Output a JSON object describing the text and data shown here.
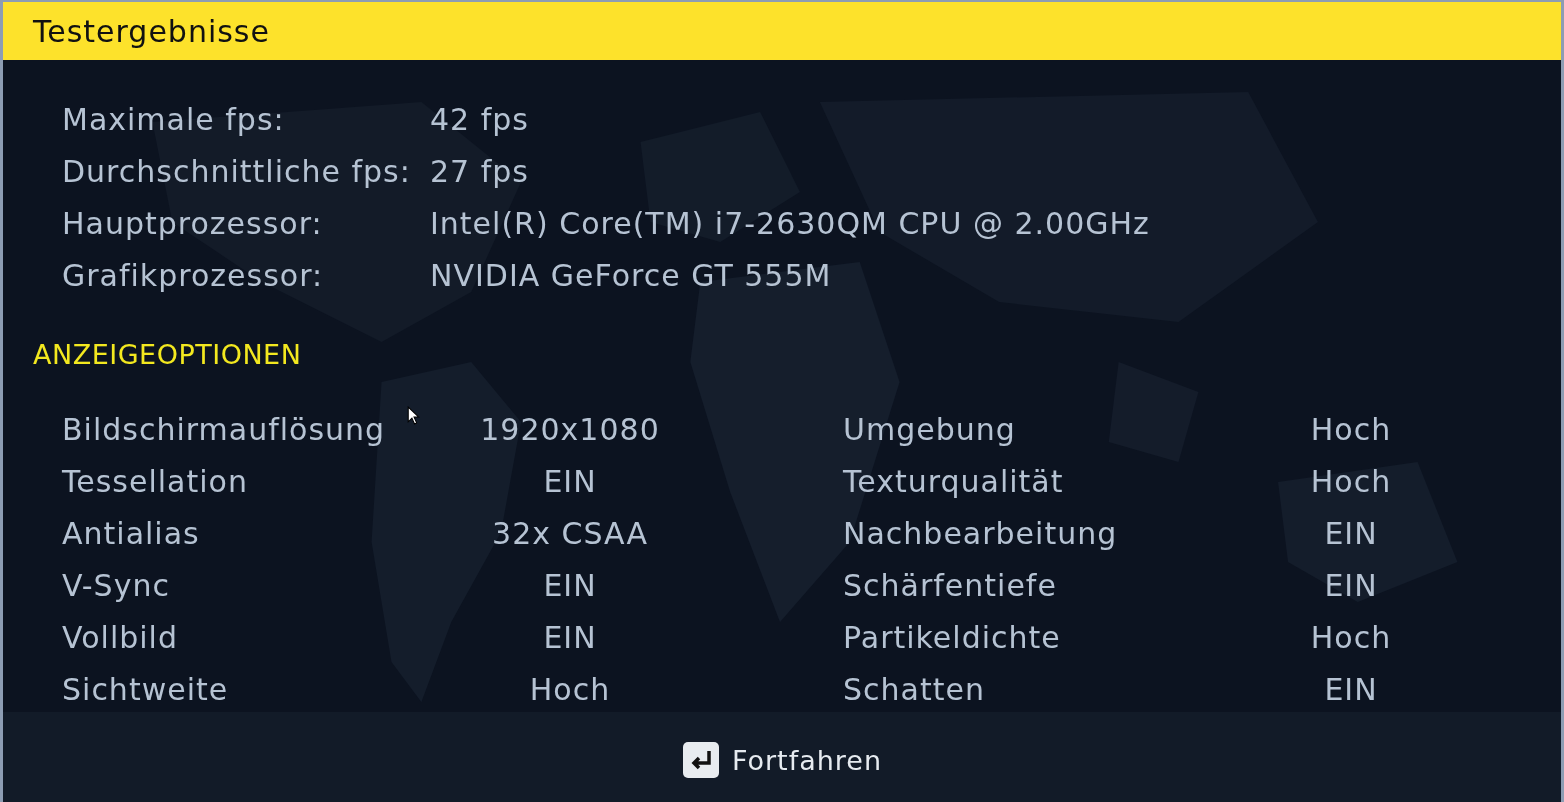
{
  "title": "Testergebnisse",
  "results": [
    {
      "label": "Maximale fps:",
      "value": "42 fps"
    },
    {
      "label": "Durchschnittliche fps:",
      "value": "27 fps"
    },
    {
      "label": "Hauptprozessor:",
      "value": "Intel(R) Core(TM) i7-2630QM CPU @ 2.00GHz"
    },
    {
      "label": "Grafikprozessor:",
      "value": "NVIDIA GeForce GT 555M"
    }
  ],
  "section_heading": "ANZEIGEOPTIONEN",
  "options": [
    {
      "left": {
        "label": "Bildschirmauflösung",
        "value": "1920x1080"
      },
      "right": {
        "label": "Umgebung",
        "value": "Hoch"
      }
    },
    {
      "left": {
        "label": "Tessellation",
        "value": "EIN"
      },
      "right": {
        "label": "Texturqualität",
        "value": "Hoch"
      }
    },
    {
      "left": {
        "label": "Antialias",
        "value": "32x CSAA"
      },
      "right": {
        "label": "Nachbearbeitung",
        "value": "EIN"
      }
    },
    {
      "left": {
        "label": "V-Sync",
        "value": "EIN"
      },
      "right": {
        "label": "Schärfentiefe",
        "value": "EIN"
      }
    },
    {
      "left": {
        "label": "Vollbild",
        "value": "EIN"
      },
      "right": {
        "label": "Partikeldichte",
        "value": "Hoch"
      }
    },
    {
      "left": {
        "label": "Sichtweite",
        "value": "Hoch"
      },
      "right": {
        "label": "Schatten",
        "value": "EIN"
      }
    }
  ],
  "continue_button": {
    "label": "Fortfahren"
  }
}
